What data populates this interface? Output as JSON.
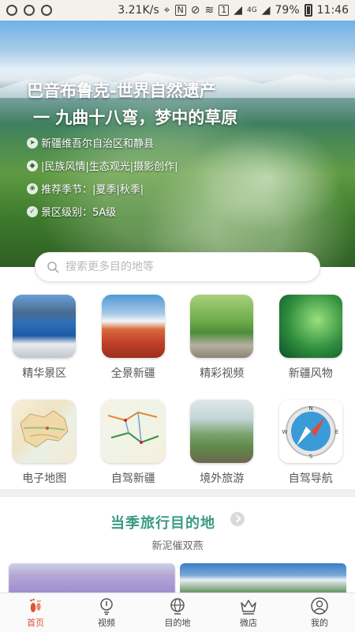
{
  "status_bar": {
    "speed": "3.21K/s",
    "battery": "79%",
    "time": "11:46",
    "network": "4G",
    "sim": "1"
  },
  "hero": {
    "title_line1": "巴音布鲁克-世界自然遗产",
    "title_line2": "一 九曲十八弯，梦中的草原",
    "location": "新疆维吾尔自治区和静县",
    "tags": "|民族风情|生态观光|摄影创作|",
    "season": "推荐季节：|夏季|秋季|",
    "level": "景区级别：5A级",
    "slide_count": 6,
    "active_slide": 2
  },
  "search": {
    "placeholder": "搜索更多目的地等"
  },
  "grid": [
    {
      "label": "精华景区",
      "icon": "lake-photo"
    },
    {
      "label": "全景新疆",
      "icon": "snow-mountain-photo"
    },
    {
      "label": "精彩视频",
      "icon": "grassland-photo"
    },
    {
      "label": "新疆风物",
      "icon": "water-plant-photo"
    },
    {
      "label": "电子地图",
      "icon": "map-icon"
    },
    {
      "label": "自驾新疆",
      "icon": "route-map-icon"
    },
    {
      "label": "境外旅游",
      "icon": "pasture-photo"
    },
    {
      "label": "自驾导航",
      "icon": "compass-icon"
    }
  ],
  "section": {
    "title": "当季旅行目的地",
    "subtitle": "新泥催双燕"
  },
  "bottom_nav": [
    {
      "label": "首页",
      "icon": "footprint-icon",
      "active": true
    },
    {
      "label": "视频",
      "icon": "bulb-icon",
      "active": false
    },
    {
      "label": "目的地",
      "icon": "globe-icon",
      "active": false
    },
    {
      "label": "微店",
      "icon": "crown-icon",
      "active": false
    },
    {
      "label": "我的",
      "icon": "user-icon",
      "active": false
    }
  ],
  "colors": {
    "accent": "#3a9a83",
    "active_tab": "#e0533b"
  }
}
